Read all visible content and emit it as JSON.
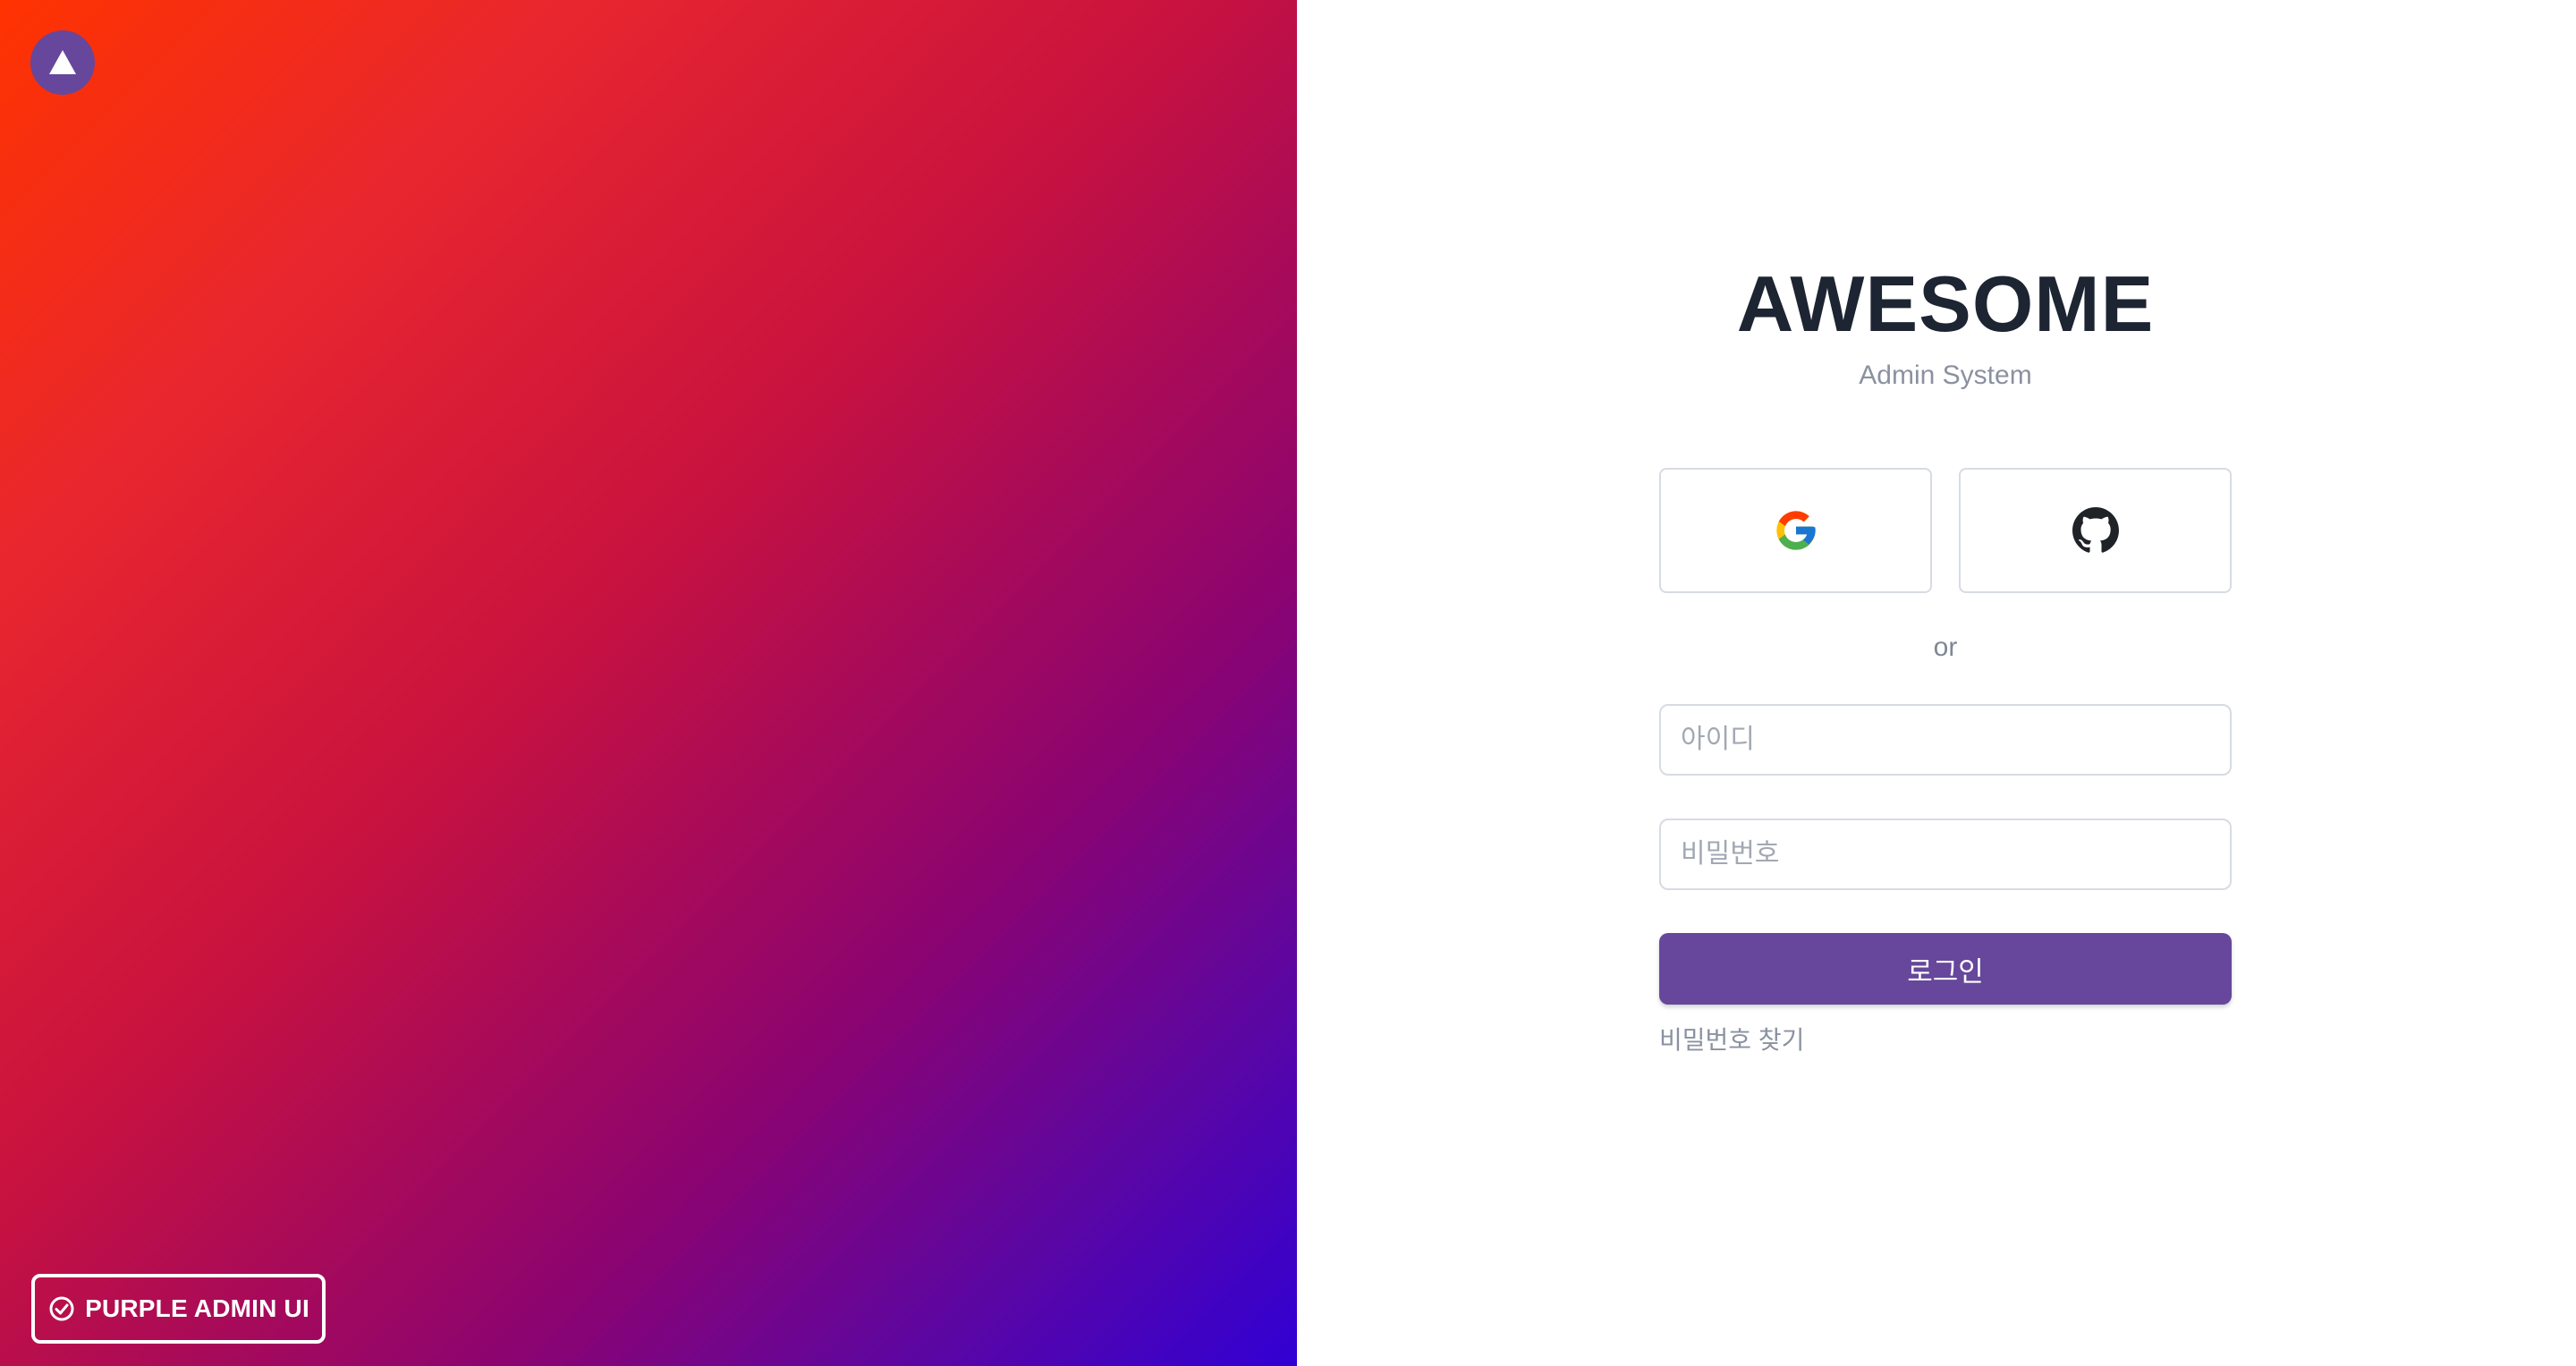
{
  "colors": {
    "brand": "#66479b",
    "gradient_start": "#ff3300",
    "gradient_end": "#3100d4",
    "title": "#1d2432",
    "muted": "#8a91a0",
    "border": "#d7dbe2"
  },
  "hero": {
    "logo_icon": "triangle-logo-icon",
    "badge_icon": "check-circle-icon",
    "badge_label": "PURPLE ADMIN UI"
  },
  "login": {
    "title": "AWESOME",
    "subtitle": "Admin System",
    "social": [
      {
        "name": "google",
        "icon": "google-icon"
      },
      {
        "name": "github",
        "icon": "github-icon"
      }
    ],
    "separator": "or",
    "username_placeholder": "아이디",
    "password_placeholder": "비밀번호",
    "submit_label": "로그인",
    "find_password_label": "비밀번호 찾기"
  }
}
